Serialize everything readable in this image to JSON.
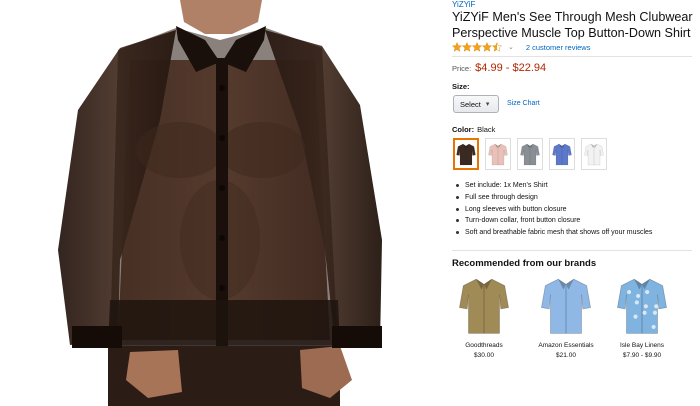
{
  "product": {
    "brand": "YiZYiF",
    "title": "YiZYiF Men's See Through Mesh Clubwear Perspective Muscle Top Button-Down Shirt",
    "rating": 4.5,
    "reviews": "2 customer reviews",
    "price_label": "Price:",
    "price": "$4.99 - $22.94",
    "size_label": "Size:",
    "size_select": "Select",
    "size_chart": "Size Chart",
    "color_label": "Color:",
    "color_value": "Black",
    "swatches": [
      {
        "name": "Black",
        "color": "#3a2a22",
        "selected": true
      },
      {
        "name": "Pink",
        "color": "#e9c1b8",
        "selected": false
      },
      {
        "name": "Gray",
        "color": "#8a8f95",
        "selected": false
      },
      {
        "name": "Blue",
        "color": "#5b78c9",
        "selected": false
      },
      {
        "name": "White",
        "color": "#f2f2f2",
        "selected": false
      }
    ],
    "bullets": [
      "Set include: 1x Men's Shirt",
      "Full see through design",
      "Long sleeves with button closure",
      "Turn-down collar, front button closure",
      "Soft and breathable fabric mesh that shows off your muscles"
    ]
  },
  "recommended": {
    "heading": "Recommended from our brands",
    "items": [
      {
        "name": "Goodthreads",
        "price": "$30.00",
        "color": "#a08a55",
        "icon": "olive-shirt-icon"
      },
      {
        "name": "Amazon Essentials",
        "price": "$21.00",
        "color": "#8fb8e6",
        "icon": "blue-shirt-icon"
      },
      {
        "name": "Isle Bay Linens",
        "price": "$7.90 - $9.90",
        "color": "#7fb3e0",
        "icon": "printed-shirt-icon"
      }
    ]
  },
  "colors": {
    "link": "#0066c0",
    "price": "#b12704",
    "star": "#f6a01a",
    "selected_border": "#e77600"
  }
}
